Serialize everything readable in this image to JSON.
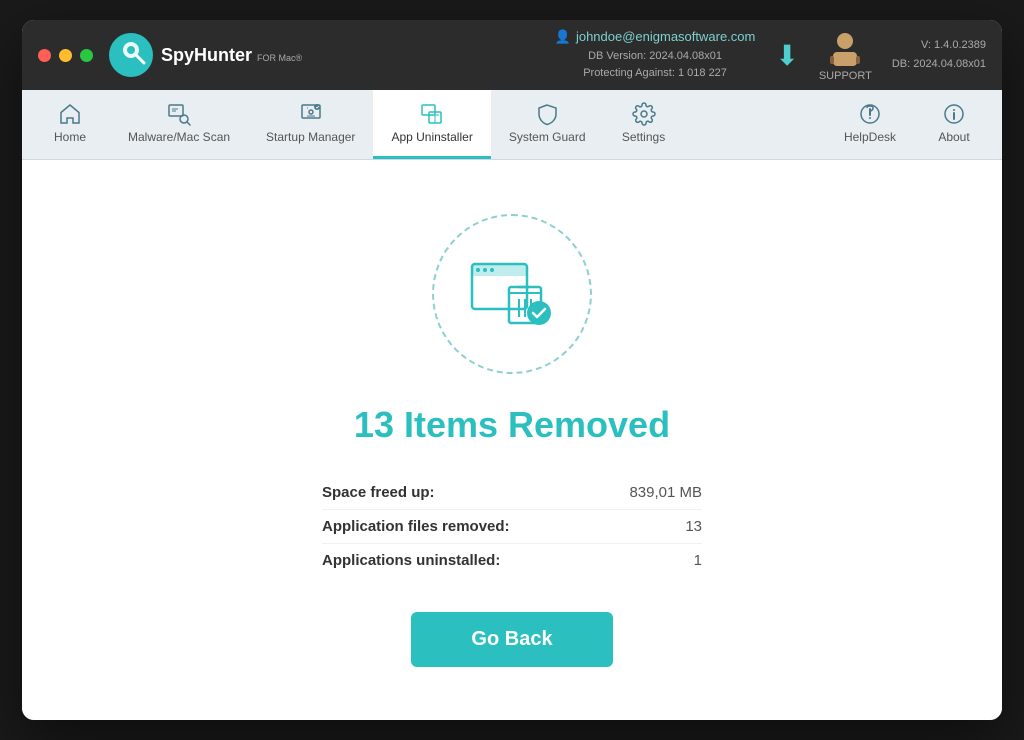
{
  "window": {
    "title": "SpyHunter for Mac"
  },
  "titlebar": {
    "logo_text": "SpyHunter",
    "logo_for_mac": "FOR Mac®",
    "email": "johndoe@enigmasoftware.com",
    "db_version_label": "DB Version:",
    "db_version": "2024.04.08x01",
    "protecting_label": "Protecting Against:",
    "protecting_count": "1 018 227",
    "support_label": "SUPPORT",
    "version": "V: 1.4.0.2389",
    "db_label": "DB:  2024.04.08x01"
  },
  "navbar": {
    "items": [
      {
        "id": "home",
        "label": "Home",
        "icon": "⌂",
        "active": false
      },
      {
        "id": "malware",
        "label": "Malware/Mac Scan",
        "icon": "🔍",
        "active": false
      },
      {
        "id": "startup",
        "label": "Startup Manager",
        "icon": "⚙",
        "active": false
      },
      {
        "id": "appuninstaller",
        "label": "App Uninstaller",
        "icon": "🗑",
        "active": true
      },
      {
        "id": "systemguard",
        "label": "System Guard",
        "icon": "🛡",
        "active": false
      },
      {
        "id": "settings",
        "label": "Settings",
        "icon": "⚙",
        "active": false
      }
    ],
    "right_items": [
      {
        "id": "helpdesk",
        "label": "HelpDesk"
      },
      {
        "id": "about",
        "label": "About"
      }
    ]
  },
  "main": {
    "result_title": "13 Items Removed",
    "stats": [
      {
        "label": "Space freed up:",
        "value": "839,01 MB"
      },
      {
        "label": "Application files removed:",
        "value": "13"
      },
      {
        "label": "Applications uninstalled:",
        "value": "1"
      }
    ],
    "go_back_label": "Go Back"
  }
}
